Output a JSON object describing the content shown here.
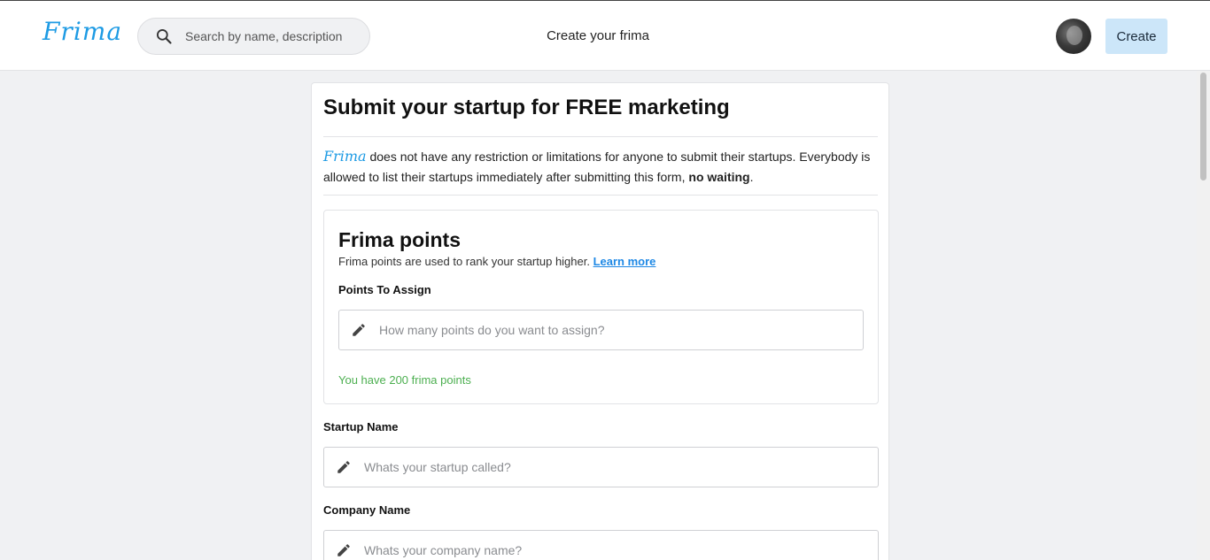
{
  "header": {
    "logo_text": "Frima",
    "search_placeholder": "Search by name, description",
    "nav_title": "Create your frima",
    "create_label": "Create"
  },
  "form": {
    "title": "Submit your startup for FREE marketing",
    "intro_logo": "Frima",
    "intro_text": " does not have any restriction or limitations for anyone to submit their startups. Everybody is allowed to list their startups immediately after submitting this form, ",
    "intro_bold": "no waiting",
    "intro_end": ".",
    "points": {
      "title": "Frima points",
      "description": "Frima points are used to rank your startup higher. ",
      "learn_more": "Learn more",
      "assign_label": "Points To Assign",
      "assign_placeholder": "How many points do you want to assign?",
      "balance": "You have 200 frima points"
    },
    "startup_name": {
      "label": "Startup Name",
      "placeholder": "Whats your startup called?"
    },
    "company_name": {
      "label": "Company Name",
      "placeholder": "Whats your company name?"
    }
  },
  "colors": {
    "brand": "#1e9be4",
    "create_button_bg": "#cce6f9",
    "success_text": "#4caf50",
    "link": "#1e88e5"
  },
  "icons": [
    "search-icon",
    "pencil-icon"
  ]
}
